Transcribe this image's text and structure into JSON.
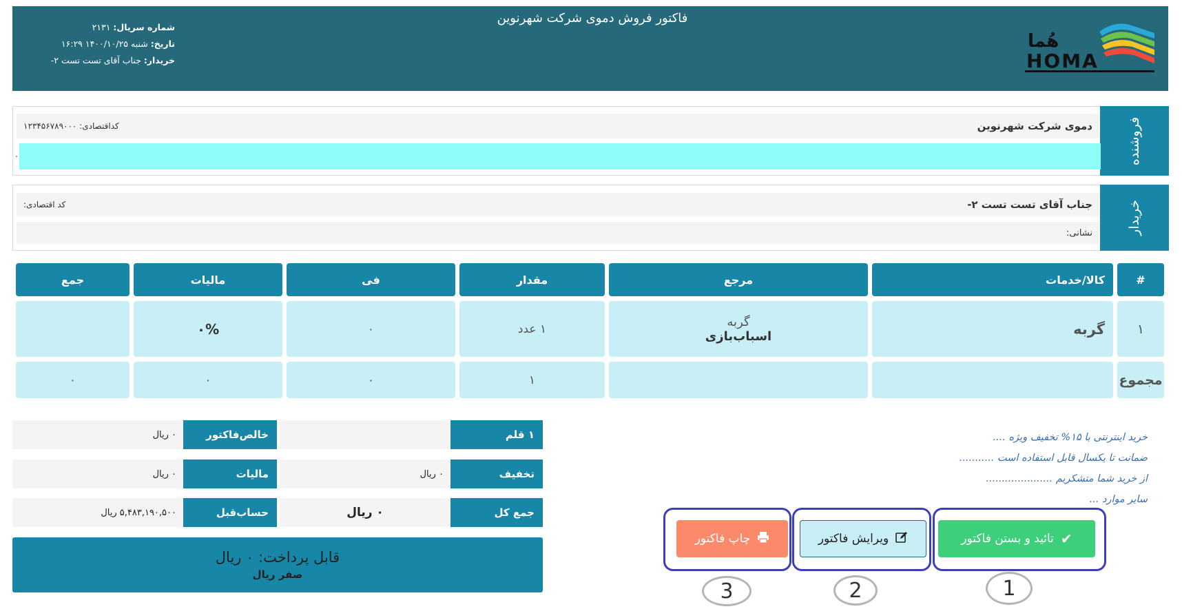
{
  "header": {
    "title": "فاکتور فروش دموی شرکت شهرنوین",
    "serial_label": "شماره سریال:",
    "serial_value": "۲۱۳۱",
    "date_label": "تاریخ:",
    "date_value": "شنبه ۱۴۰۰/۱۰/۲۵",
    "time_value": "۱۶:۲۹",
    "buyer_label": "خریدار:",
    "buyer_value": "جناب آقای تست تست ۲-",
    "logo_text": "HOMA",
    "logo_text_fa": "هُما"
  },
  "seller": {
    "tab_label": "فروشنده",
    "name": "دموی شرکت شهرنوین",
    "econ_code": "کداقتصادی: ۱۲۳۴۵۶۷۸۹۰۰۰",
    "address_dot": "."
  },
  "buyer": {
    "tab_label": "خریدار",
    "name": "جناب آقای تست تست ۲-",
    "econ_code": "کد اقتصادی:",
    "address": "نشانی:"
  },
  "table": {
    "headers": [
      "#",
      "کالا/خدمات",
      "مرجع",
      "مقدار",
      "فی",
      "مالیات",
      "جمع"
    ],
    "row": {
      "index": "۱",
      "product": "گربه",
      "ref_line1": "گربه",
      "ref_line2": "اسباب‌بازی",
      "qty": "۱ عدد",
      "price": "۰",
      "tax": "۰%",
      "total": ""
    },
    "totals": {
      "label": "مجموع",
      "product": "",
      "ref": "",
      "qty": "۱",
      "price": "۰",
      "tax": "۰",
      "total": "۰"
    }
  },
  "summary": {
    "items_count_label": "۱ قلم",
    "items_count_value": "",
    "discount_label": "تخفیف",
    "discount_value": "۰ ریال",
    "grand_total_label": "جمع کل",
    "grand_total_value": "۰ ریال",
    "net_label": "خالص‌فاکتور",
    "net_value": "۰ ریال",
    "tax_label": "مالیات",
    "tax_value": "۰ ریال",
    "prev_label": "حساب‌قبل",
    "prev_value": "۵,۴۸۳,۱۹۰,۵۰۰ ریال",
    "payable": "قابل پرداخت: ۰ ریال",
    "payable_words": "صفر ریال"
  },
  "notes": [
    "خرید اینترنتی با ۱۵% تخفیف ویژه ....",
    "ضمانت تا یکسال قابل استفاده است ...........",
    "از خرید شما متشکریم .....................",
    "سایر موارد ..."
  ],
  "actions": {
    "confirm_label": "تائید و بستن فاکتور",
    "edit_label": "ویرایش فاکتور",
    "print_label": "چاپ فاکتور",
    "marker_1": "1",
    "marker_2": "2",
    "marker_3": "3"
  },
  "colors": {
    "header_bg": "#26697a",
    "accent": "#1886a7",
    "cell_bg": "#c9eff6",
    "confirm": "#3ecf7a",
    "edit": "#c9eff6",
    "print": "#fa8a6a",
    "frame": "#3b3fb8"
  }
}
